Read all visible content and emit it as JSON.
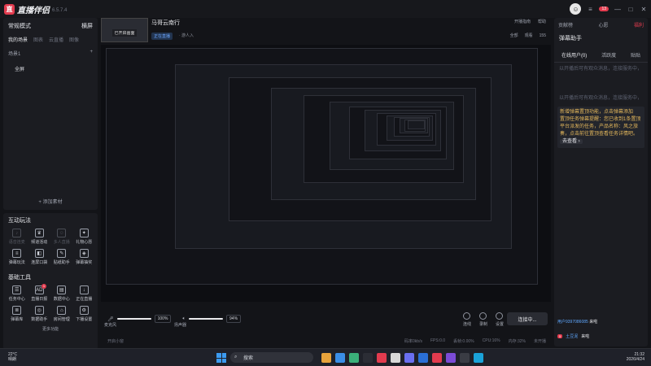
{
  "app": {
    "name": "直播伴侣",
    "version": "6.5.7.4",
    "logo_char": "直"
  },
  "window_controls": {
    "minimize": "—",
    "maximize": "□",
    "close": "✕",
    "menu": "≡",
    "badge": "13"
  },
  "left": {
    "mode_label": "常规模式",
    "mode_extra": "横屏",
    "scene_tabs": [
      "我的场景",
      "图表",
      "云直播",
      "图像"
    ],
    "scene_name": "场景1",
    "source_item": "全屏",
    "add_source": "+ 添加素材"
  },
  "tools": {
    "section1": "互动玩法",
    "section2": "基础工具",
    "grid1": [
      {
        "label": "语音连麦",
        "icon": "mic-icon",
        "dim": true
      },
      {
        "label": "频道活动",
        "icon": "trophy-icon",
        "dim": false
      },
      {
        "label": "多人直播",
        "icon": "group-icon",
        "dim": true
      },
      {
        "label": "礼物心愿",
        "icon": "gift-icon",
        "dim": false
      },
      {
        "label": "弹幕玩法",
        "icon": "danmaku-icon",
        "dim": false
      },
      {
        "label": "连屏口袋",
        "icon": "pocket-icon",
        "dim": false
      },
      {
        "label": "贴纸助手",
        "icon": "sticker-icon",
        "dim": false
      },
      {
        "label": "弹幕抽奖",
        "icon": "lottery-icon",
        "dim": false
      }
    ],
    "grid2": [
      {
        "label": "任务中心",
        "icon": "task-icon",
        "badge": ""
      },
      {
        "label": "直播日报",
        "icon": "ad-icon",
        "badge": "1"
      },
      {
        "label": "数据中心",
        "icon": "data-icon",
        "badge": ""
      },
      {
        "label": "正在直播",
        "icon": "download-icon",
        "badge": ""
      },
      {
        "label": "弹幕库",
        "icon": "list-icon",
        "badge": ""
      },
      {
        "label": "数据助手",
        "icon": "assist-icon",
        "badge": ""
      },
      {
        "label": "房间管理",
        "icon": "room-icon",
        "badge": ""
      },
      {
        "label": "下播设置",
        "icon": "settings-icon",
        "badge": ""
      }
    ],
    "more": "更多功能"
  },
  "header": {
    "preview_label": "已开启画面",
    "room_title": "马哥云南行",
    "room_tag": "正在直播",
    "room_tag2": "· 游人入",
    "top_tools": [
      "开播指南",
      "帮助"
    ],
    "bottom_tools": [
      "全部",
      "观看",
      "155"
    ]
  },
  "audio": {
    "mic_label": "麦克风",
    "mic_value": "100%",
    "speaker_label": "扬声器",
    "speaker_value": "94%",
    "controls": [
      "连线",
      "录制",
      "设置"
    ],
    "go_live": "连接中..."
  },
  "status": {
    "scene": "开启小窗",
    "stats": [
      "码率0kb/s",
      "FPS:0.0",
      "丢帧:0.00%",
      "CPU:16%",
      "内存:32%",
      "未开播"
    ]
  },
  "right": {
    "top_tabs": [
      "贡献榜",
      "心愿",
      "福利"
    ],
    "title": "弹幕助手",
    "subtabs": [
      "在线用户(0)",
      "活跃度",
      "贴贴"
    ],
    "hint1": "以开播后可有观众消息，连接服务中，",
    "hint2": "以开播后可有观众消息，连接服务中，",
    "notice_line1": "新增弹幕置顶功能，点击弹幕添加",
    "notice_line2": "置顶任务弹幕提醒：您已收到1条置顶",
    "notice_line3": "平台派发的任务，产品名称：风之旅",
    "notice_line4": "奏，点击前往置顶查看任务详情吧。",
    "notice_link": "去查看 ›",
    "gift_user": "用户9397086085",
    "gift_text": "来啦",
    "ticker_user": "土豆泥",
    "ticker_text": "来啦",
    "ticker_lvl": "5"
  },
  "taskbar": {
    "weather_temp": "22°C",
    "weather_text": "晴朗",
    "search_placeholder": "搜索",
    "time": "21:32",
    "date": "2026/4/24"
  }
}
